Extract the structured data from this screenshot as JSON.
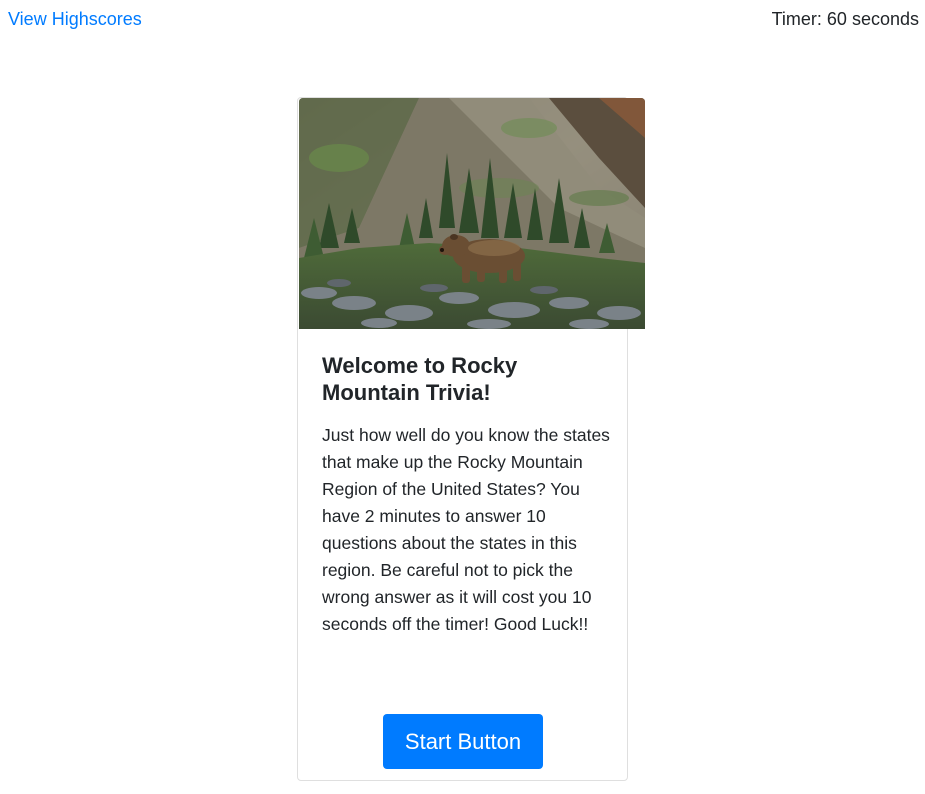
{
  "header": {
    "highscores_link": "View Highscores",
    "timer_text": "Timer: 60 seconds"
  },
  "card": {
    "image_subject": "grizzly-bear-mountain-photo",
    "title": "Welcome to Rocky Mountain Trivia!",
    "description": "Just how well do you know the states that make up the Rocky Mountain Region of the United States? You have 2 minutes to answer 10 questions about the states in this region. Be careful not to pick the wrong answer as it will cost you 10 seconds off the timer! Good Luck!!",
    "start_button_label": "Start Button"
  },
  "colors": {
    "link": "#007bff",
    "button_bg": "#007bff",
    "button_text": "#ffffff",
    "text": "#212529",
    "card_border": "#dfdfdf"
  }
}
